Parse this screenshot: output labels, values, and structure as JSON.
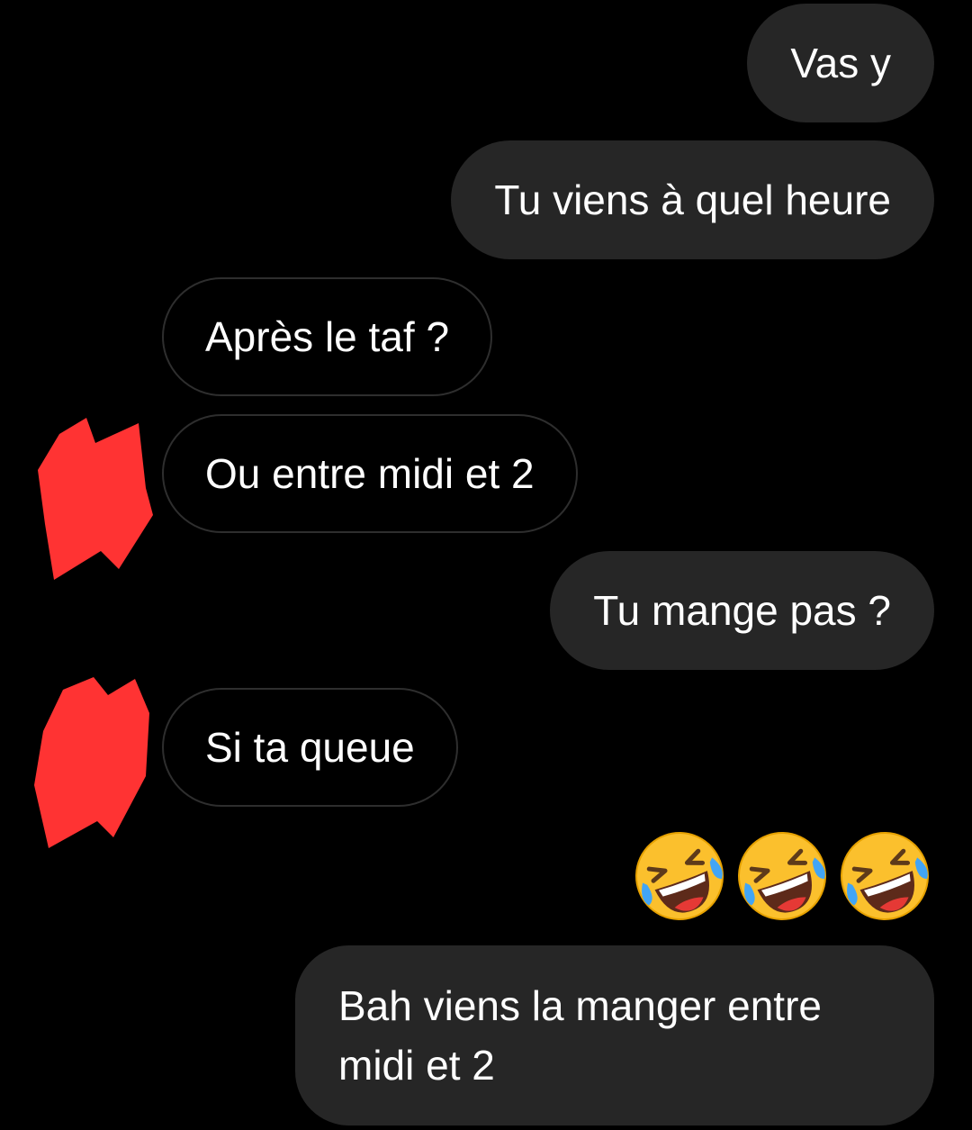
{
  "conversation": {
    "messages": [
      {
        "side": "sent",
        "text": "Vas y"
      },
      {
        "side": "sent",
        "text": "Tu viens à quel heure"
      },
      {
        "side": "received",
        "text": "Après le taf ?"
      },
      {
        "side": "received",
        "text": "Ou entre midi et 2"
      },
      {
        "side": "sent",
        "text": "Tu mange pas ?"
      },
      {
        "side": "received",
        "text": "Si ta queue"
      },
      {
        "side": "sent",
        "text": "Bah viens la manger entre midi et 2"
      }
    ],
    "reactions": {
      "emoji": [
        "rolling-on-the-floor-laughing",
        "rolling-on-the-floor-laughing",
        "rolling-on-the-floor-laughing"
      ]
    }
  },
  "colors": {
    "background": "#000000",
    "sent_bubble": "#262626",
    "received_border": "#2e2e2e",
    "text": "#ffffff",
    "redaction": "#ff3333"
  }
}
